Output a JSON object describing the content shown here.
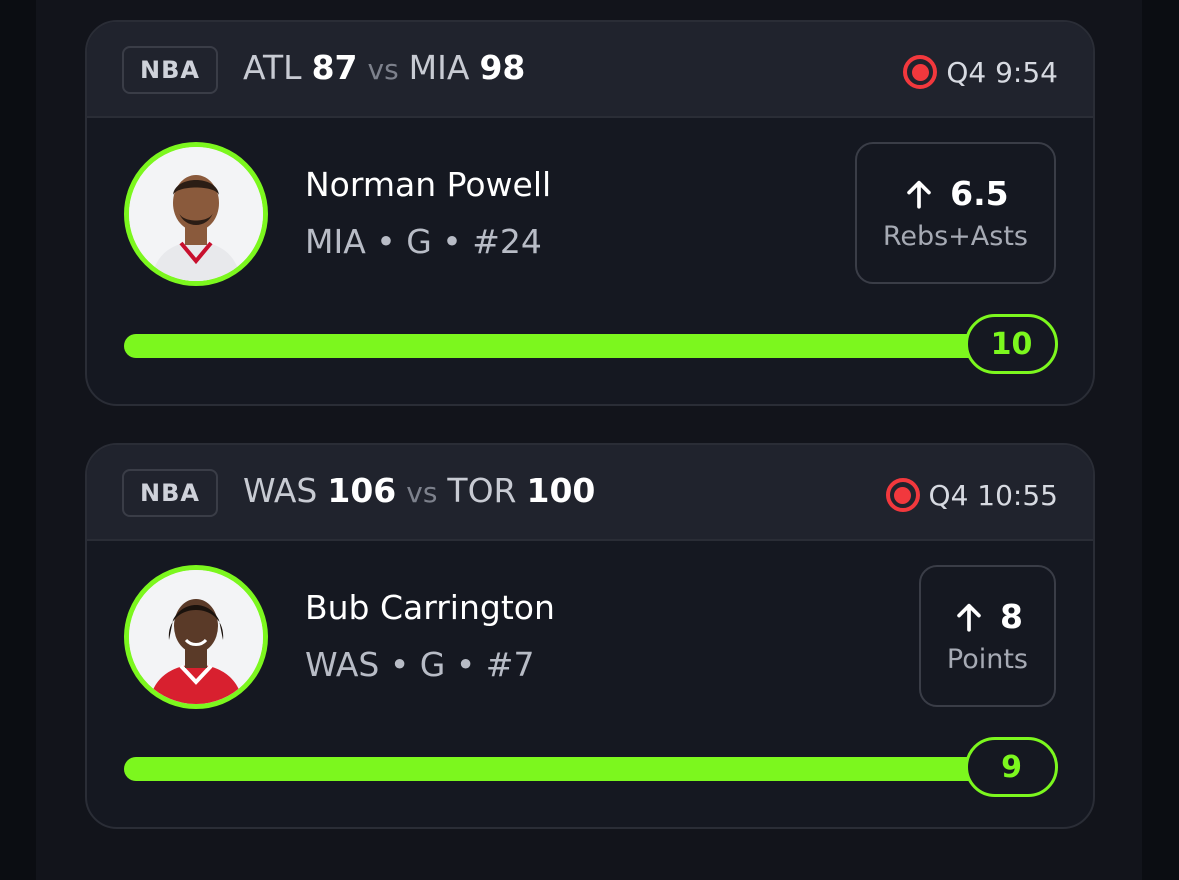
{
  "cards": [
    {
      "league": "NBA",
      "away_team": "ATL",
      "away_score": "87",
      "vs": "vs",
      "home_team": "MIA",
      "home_score": "98",
      "status": "Q4 9:54",
      "player": {
        "name": "Norman Powell",
        "meta": "MIA • G • #24",
        "jersey_color": "#e8e9ec",
        "accent": "#c8102e"
      },
      "prop": {
        "direction": "up-arrow-icon",
        "line": "6.5",
        "stat": "Rebs+Asts"
      },
      "progress": {
        "value": "10",
        "fraction": 1.0
      }
    },
    {
      "league": "NBA",
      "away_team": "WAS",
      "away_score": "106",
      "vs": "vs",
      "home_team": "TOR",
      "home_score": "100",
      "status": "Q4 10:55",
      "player": {
        "name": "Bub Carrington",
        "meta": "WAS • G • #7",
        "jersey_color": "#d8202f",
        "accent": "#ffffff"
      },
      "prop": {
        "direction": "up-arrow-icon",
        "line": "8",
        "stat": "Points"
      },
      "progress": {
        "value": "9",
        "fraction": 1.0
      }
    }
  ],
  "colors": {
    "accent_green": "#7cf71e",
    "live_red": "#f2383d"
  }
}
